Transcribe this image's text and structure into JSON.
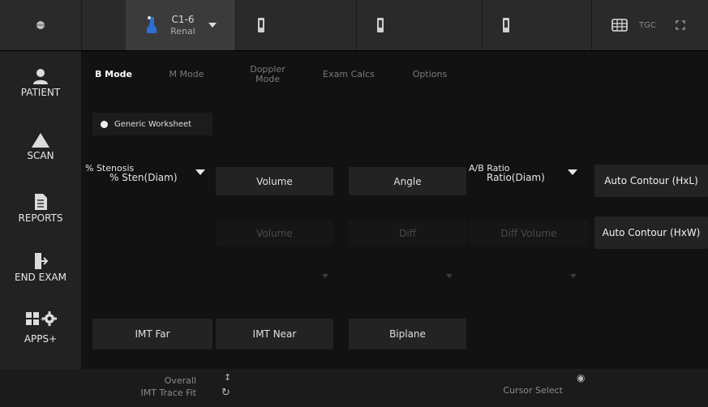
{
  "topbar": {
    "probe_name": "C1-6",
    "probe_preset": "Renal",
    "tgc_label": "TGC"
  },
  "leftnav": {
    "items": [
      {
        "label": "PATIENT",
        "icon": "patient-icon"
      },
      {
        "label": "SCAN",
        "icon": "scan-icon"
      },
      {
        "label": "REPORTS",
        "icon": "reports-icon"
      },
      {
        "label": "END EXAM",
        "icon": "end-exam-icon"
      },
      {
        "label": "APPS+",
        "icon": "apps-gear-icon"
      }
    ]
  },
  "tabs": [
    {
      "label": "B Mode"
    },
    {
      "label": "M Mode"
    },
    {
      "label": "Doppler Mode"
    },
    {
      "label": "Exam Calcs"
    },
    {
      "label": "Options"
    }
  ],
  "worksheet": {
    "label": "Generic Worksheet"
  },
  "stenosis": {
    "title": "% Stenosis",
    "value": "% Sten(Diam)"
  },
  "ab_ratio": {
    "title": "A/B Ratio",
    "value": "Ratio(Diam)"
  },
  "buttons": {
    "volume": "Volume",
    "angle": "Angle",
    "auto_contour_hxl": "Auto Contour (HxL)",
    "auto_contour_hxw": "Auto Contour (HxW)",
    "imt_far": "IMT Far",
    "imt_near": "IMT Near",
    "biplane": "Biplane"
  },
  "disabled": {
    "volume2": "Volume",
    "diff": "Diff",
    "diff_volume": "Diff Volume"
  },
  "bottombar": {
    "overall": "Overall",
    "imt_trace_fit": "IMT Trace Fit",
    "cursor_select": "Cursor Select"
  }
}
